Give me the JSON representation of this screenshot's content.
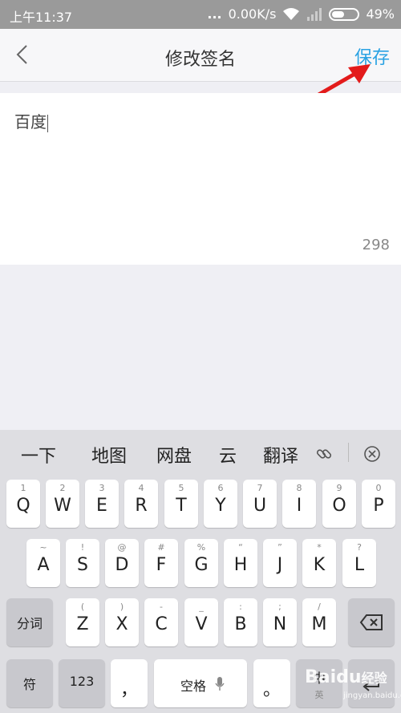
{
  "status": {
    "time": "上午11:37",
    "dots": "...",
    "speed": "0.00K/s",
    "battery": "49%",
    "battery_level": 0.49
  },
  "header": {
    "title": "修改签名",
    "save": "保存"
  },
  "editor": {
    "text": "百度",
    "counter": "298"
  },
  "keyboard": {
    "suggestions": [
      "一下",
      "地图",
      "网盘",
      "云",
      "翻译"
    ],
    "row1": [
      {
        "sub": "1",
        "main": "Q"
      },
      {
        "sub": "2",
        "main": "W"
      },
      {
        "sub": "3",
        "main": "E"
      },
      {
        "sub": "4",
        "main": "R"
      },
      {
        "sub": "5",
        "main": "T"
      },
      {
        "sub": "6",
        "main": "Y"
      },
      {
        "sub": "7",
        "main": "U"
      },
      {
        "sub": "8",
        "main": "I"
      },
      {
        "sub": "9",
        "main": "O"
      },
      {
        "sub": "0",
        "main": "P"
      }
    ],
    "row2": [
      {
        "sub": "~",
        "main": "A"
      },
      {
        "sub": "!",
        "main": "S"
      },
      {
        "sub": "@",
        "main": "D"
      },
      {
        "sub": "#",
        "main": "F"
      },
      {
        "sub": "%",
        "main": "G"
      },
      {
        "sub": "“",
        "main": "H"
      },
      {
        "sub": "”",
        "main": "J"
      },
      {
        "sub": "*",
        "main": "K"
      },
      {
        "sub": "?",
        "main": "L"
      }
    ],
    "row3_left": "分词",
    "row3": [
      {
        "sub": "(",
        "main": "Z"
      },
      {
        "sub": ")",
        "main": "X"
      },
      {
        "sub": "-",
        "main": "C"
      },
      {
        "sub": "_",
        "main": "V"
      },
      {
        "sub": ":",
        "main": "B"
      },
      {
        "sub": ";",
        "main": "N"
      },
      {
        "sub": "/",
        "main": "M"
      }
    ],
    "row4": {
      "sym": "符",
      "num": "123",
      "comma": "，",
      "space": "空格",
      "period": "。",
      "lang": "中",
      "lang_sub": "英"
    }
  },
  "watermark": {
    "brand": "Baidu",
    "text": "经验",
    "url": "jingyan.baidu.com"
  }
}
